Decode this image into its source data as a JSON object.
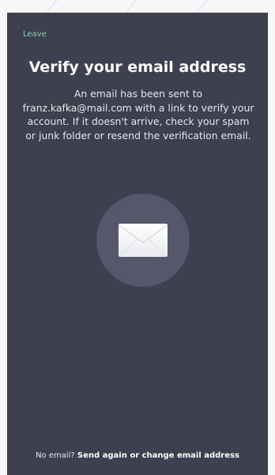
{
  "header": {
    "leave_label": "Leave"
  },
  "main": {
    "title": "Verify your email address",
    "description": "An email has been sent to franz.kafka@mail.com with a link to verify your account. If it doesn't arrive, check your spam or junk folder or resend the verification email.",
    "icon": "envelope-icon"
  },
  "footer": {
    "prompt": "No email? ",
    "action_label": "Send again or change email address"
  },
  "colors": {
    "background": "#3f404f",
    "accent": "#8fcfae",
    "icon_circle": "#55576a"
  }
}
